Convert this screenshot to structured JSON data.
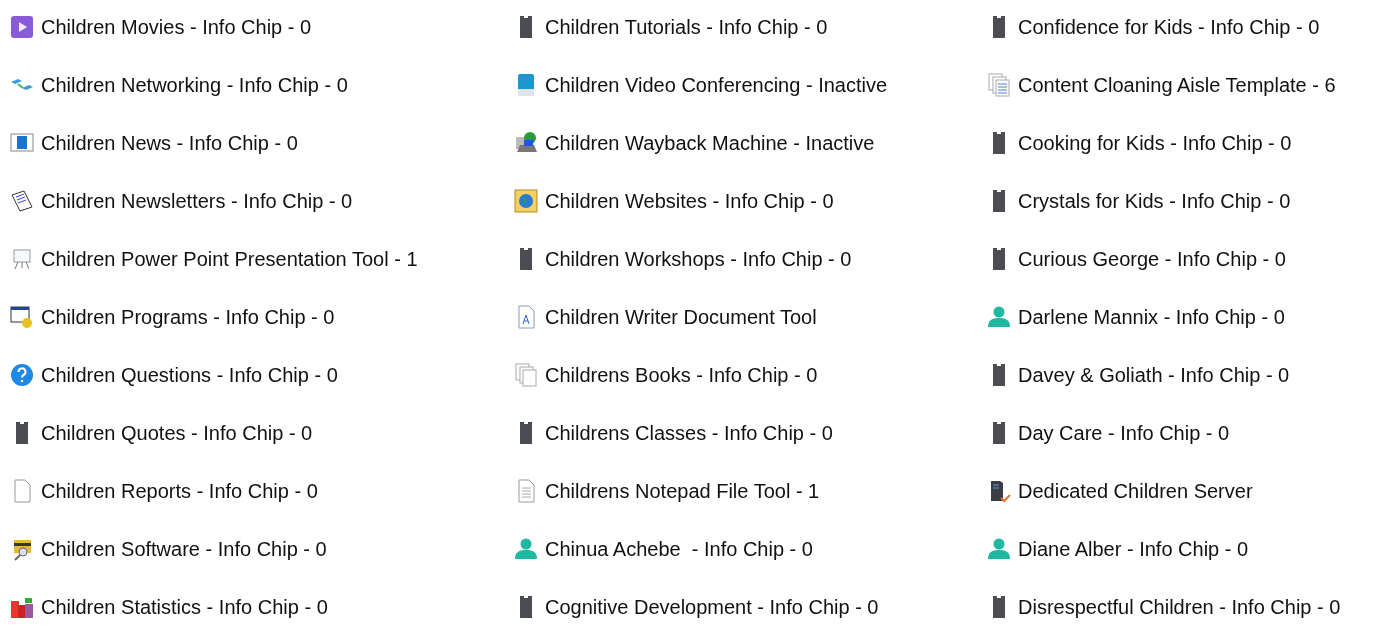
{
  "items": [
    {
      "label": "Children Movies - Info Chip - 0",
      "kind": "video"
    },
    {
      "label": "Children Networking - Info Chip - 0",
      "kind": "network"
    },
    {
      "label": "Children News - Info Chip - 0",
      "kind": "news"
    },
    {
      "label": "Children Newsletters - Info Chip - 0",
      "kind": "newsletter"
    },
    {
      "label": "Children Power Point Presentation Tool - 1",
      "kind": "presentation"
    },
    {
      "label": "Children Programs - Info Chip - 0",
      "kind": "programs"
    },
    {
      "label": "Children Questions - Info Chip - 0",
      "kind": "question"
    },
    {
      "label": "Children Quotes - Info Chip - 0",
      "kind": "chip"
    },
    {
      "label": "Children Reports - Info Chip - 0",
      "kind": "pages"
    },
    {
      "label": "Children Software - Info Chip - 0",
      "kind": "software"
    },
    {
      "label": "Children Statistics - Info Chip - 0",
      "kind": "statistics"
    },
    {
      "label": "Children Tutorials - Info Chip - 0",
      "kind": "chip"
    },
    {
      "label": "Children Video Conferencing - Inactive",
      "kind": "tablet"
    },
    {
      "label": "Children Wayback Machine - Inactive",
      "kind": "web"
    },
    {
      "label": "Children Websites - Info Chip - 0",
      "kind": "website"
    },
    {
      "label": "Children Workshops - Info Chip - 0",
      "kind": "chip"
    },
    {
      "label": "Children Writer Document Tool",
      "kind": "writer"
    },
    {
      "label": "Childrens Books - Info Chip - 0",
      "kind": "books"
    },
    {
      "label": "Childrens Classes - Info Chip - 0",
      "kind": "chip"
    },
    {
      "label": "Childrens Notepad File Tool - 1",
      "kind": "notepad"
    },
    {
      "label": "Chinua Achebe  - Info Chip - 0",
      "kind": "person"
    },
    {
      "label": "Cognitive Development - Info Chip - 0",
      "kind": "chip"
    },
    {
      "label": "Confidence for Kids - Info Chip - 0",
      "kind": "chip"
    },
    {
      "label": "Content Cloaning Aisle Template - 6",
      "kind": "template"
    },
    {
      "label": "Cooking for Kids - Info Chip - 0",
      "kind": "chip"
    },
    {
      "label": "Crystals for Kids - Info Chip - 0",
      "kind": "chip"
    },
    {
      "label": "Curious George - Info Chip - 0",
      "kind": "chip"
    },
    {
      "label": "Darlene Mannix - Info Chip - 0",
      "kind": "person"
    },
    {
      "label": "Davey & Goliath - Info Chip - 0",
      "kind": "chip"
    },
    {
      "label": "Day Care - Info Chip - 0",
      "kind": "chip"
    },
    {
      "label": "Dedicated Children Server",
      "kind": "server"
    },
    {
      "label": "Diane Alber - Info Chip - 0",
      "kind": "person"
    },
    {
      "label": "Disrespectful Children - Info Chip - 0",
      "kind": "chip"
    }
  ]
}
